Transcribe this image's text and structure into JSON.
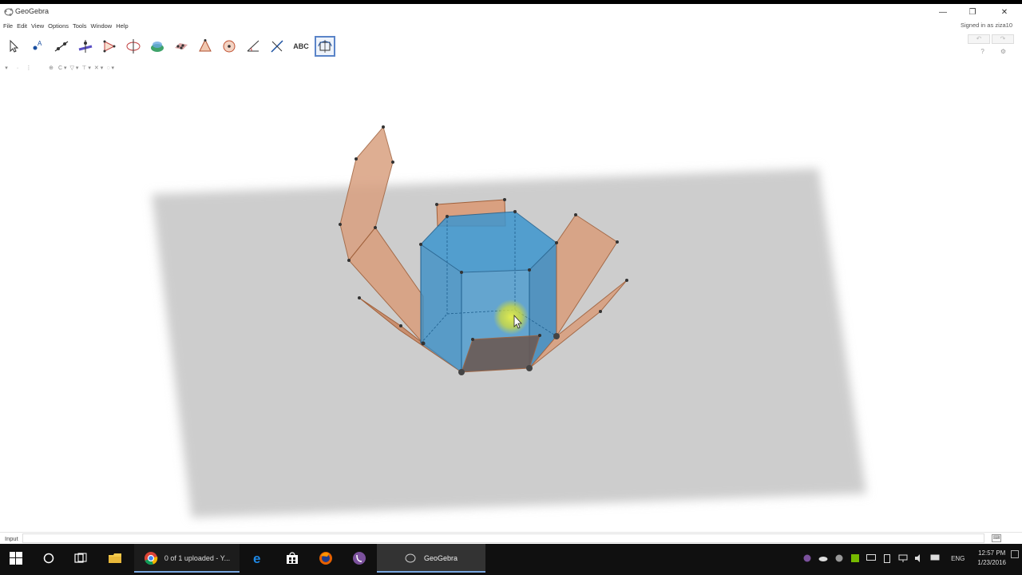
{
  "window": {
    "title": "GeoGebra",
    "controls": {
      "minimize": "—",
      "maximize": "❐",
      "close": "✕"
    }
  },
  "menu": [
    "File",
    "Edit",
    "View",
    "Options",
    "Tools",
    "Window",
    "Help"
  ],
  "account": {
    "signed_in_text": "Signed in as ziza10"
  },
  "toolbar": {
    "tools": [
      {
        "icon": "move-arrow-icon"
      },
      {
        "icon": "point-icon"
      },
      {
        "icon": "line-icon"
      },
      {
        "icon": "perpendicular-line-icon"
      },
      {
        "icon": "polygon-icon"
      },
      {
        "icon": "circle-axis-icon"
      },
      {
        "icon": "intersect-surfaces-icon"
      },
      {
        "icon": "plane-icon"
      },
      {
        "icon": "pyramid-icon"
      },
      {
        "icon": "sphere-icon"
      },
      {
        "icon": "angle-icon"
      },
      {
        "icon": "reflect-icon"
      },
      {
        "icon": "text-tool-icon",
        "label": "ABC"
      },
      {
        "icon": "rotate-view-icon",
        "selected": true
      }
    ],
    "help_left": "?",
    "help_right": "⚙"
  },
  "stylebar": [
    "▾",
    "·",
    "⋮",
    "",
    "⊕",
    "C ▾",
    "▽ ▾",
    "⊤ ▾",
    "✕ ▾",
    "◌ ▾"
  ],
  "input_bar": {
    "label": "Input",
    "value": "",
    "keyboard_icon": "keyboard-icon"
  },
  "taskbar": {
    "items": [
      {
        "icon": "windows-start-icon"
      },
      {
        "icon": "search-circle-icon"
      },
      {
        "icon": "task-view-icon"
      },
      {
        "icon": "file-explorer-icon"
      },
      {
        "icon": "chrome-icon",
        "label": "0 of 1 uploaded - Y..."
      },
      {
        "icon": "edge-icon"
      },
      {
        "icon": "store-icon"
      },
      {
        "icon": "firefox-icon"
      },
      {
        "icon": "viber-icon"
      },
      {
        "icon": "geogebra-icon",
        "label": "GeoGebra"
      }
    ],
    "language": "ENG",
    "time": "12:57 PM",
    "date": "1/23/2016"
  },
  "colors": {
    "prism_blue": "#3b8fc6",
    "net_face": "#d9a080",
    "bottom_face": "#6b5a55",
    "plane_gray": "#cdcdcd",
    "accent_blue": "#5a84c8"
  }
}
